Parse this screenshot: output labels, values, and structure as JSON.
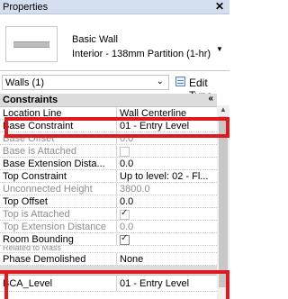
{
  "panel": {
    "title": "Properties",
    "close_glyph": "✕"
  },
  "type_selector": {
    "family": "Basic Wall",
    "type": "Interior - 138mm Partition (1-hr)",
    "dropdown_icon": "chevron-down-icon"
  },
  "instance_selector": {
    "label": "Walls (1)",
    "dropdown_icon": "chevron-down-icon"
  },
  "edit_type": {
    "label": "Edit Type"
  },
  "constraints": {
    "header": "Constraints",
    "collapse_glyph": "«",
    "rows": [
      {
        "key": "Location Line",
        "value": "Wall Centerline"
      },
      {
        "key": "Base Constraint",
        "value": "01 - Entry Level"
      },
      {
        "key": "Base Offset",
        "value": "0.0"
      },
      {
        "key": "Base is Attached",
        "value": ""
      },
      {
        "key": "Base Extension Dista...",
        "value": "0.0"
      },
      {
        "key": "Top Constraint",
        "value": "Up to level: 02 - Fl..."
      },
      {
        "key": "Unconnected Height",
        "value": "3800.0"
      },
      {
        "key": "Top Offset",
        "value": "0.0"
      },
      {
        "key": "Top is Attached",
        "value": ""
      },
      {
        "key": "Top Extension Distance",
        "value": "0.0"
      },
      {
        "key": "Room Bounding",
        "value": ""
      },
      {
        "key": "Related to Mass",
        "value": ""
      },
      {
        "key": "Phase Demolished",
        "value": "None"
      }
    ]
  },
  "other": {
    "rows": [
      {
        "key": "BCA_Level",
        "value": "01 - Entry Level"
      }
    ]
  },
  "colors": {
    "highlight": "#e0191e",
    "header_bg": "#d3deee"
  }
}
